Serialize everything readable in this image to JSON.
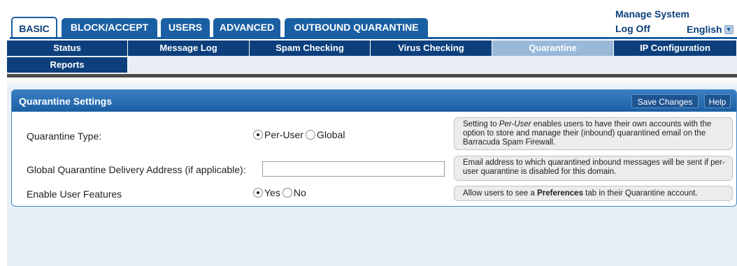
{
  "top_tabs": [
    {
      "label": "BASIC",
      "active": true
    },
    {
      "label": "BLOCK/ACCEPT",
      "active": false
    },
    {
      "label": "USERS",
      "active": false
    },
    {
      "label": "ADVANCED",
      "active": false
    },
    {
      "label": "OUTBOUND QUARANTINE",
      "active": false
    }
  ],
  "system_links": {
    "manage_system": "Manage System",
    "log_off": "Log Off",
    "language": "English"
  },
  "sub_nav": [
    {
      "label": "Status",
      "active": false
    },
    {
      "label": "Message Log",
      "active": false
    },
    {
      "label": "Spam Checking",
      "active": false
    },
    {
      "label": "Virus Checking",
      "active": false
    },
    {
      "label": "Quarantine",
      "active": true
    },
    {
      "label": "IP Configuration",
      "active": false
    },
    {
      "label": "Reports",
      "active": false
    }
  ],
  "panel": {
    "title": "Quarantine Settings",
    "save_label": "Save Changes",
    "help_label": "Help"
  },
  "settings": {
    "quarantine_type": {
      "label": "Quarantine Type:",
      "options": [
        "Per-User",
        "Global"
      ],
      "selected": "Per-User",
      "help_prefix": "Setting to ",
      "help_italic": "Per-User",
      "help_suffix": " enables users to have their own accounts with the option to store and manage their (inbound) quarantined email on the Barracuda Spam Firewall."
    },
    "delivery_address": {
      "label": "Global Quarantine Delivery Address (if applicable):",
      "value": "",
      "help": "Email address to which quarantined inbound messages will be sent if per-user quarantine is disabled for this domain."
    },
    "user_features": {
      "label": "Enable User Features",
      "options": [
        "Yes",
        "No"
      ],
      "selected": "Yes",
      "help_prefix": "Allow users to see a ",
      "help_bold": "Preferences",
      "help_suffix": " tab in their Quarantine account."
    }
  },
  "colors": {
    "brand_blue": "#1a5fa3",
    "dark_navy": "#0c3f7c",
    "active_subtab": "#9ab8d8"
  }
}
